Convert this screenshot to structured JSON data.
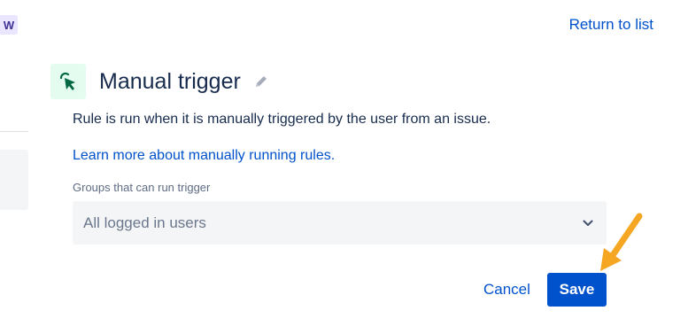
{
  "edge": {
    "badge_text": "W"
  },
  "header": {
    "return_link": "Return to list",
    "title": "Manual trigger",
    "trigger_icon": "cursor-click-icon",
    "edit_icon": "pencil-icon"
  },
  "main": {
    "description": "Rule is run when it is manually triggered by the user from an issue.",
    "learn_more_link": "Learn more about manually running rules.",
    "groups_field": {
      "label": "Groups that can run trigger",
      "selected_value": "All logged in users",
      "icon": "chevron-down-icon"
    }
  },
  "actions": {
    "cancel_label": "Cancel",
    "save_label": "Save"
  },
  "annotation": {
    "icon": "arrow-pointer-icon",
    "color": "#f5a623"
  },
  "colors": {
    "accent": "#0052cc",
    "trigger_bg": "#e3fcef",
    "trigger_fg": "#006644",
    "field_bg": "#f4f5f7"
  }
}
